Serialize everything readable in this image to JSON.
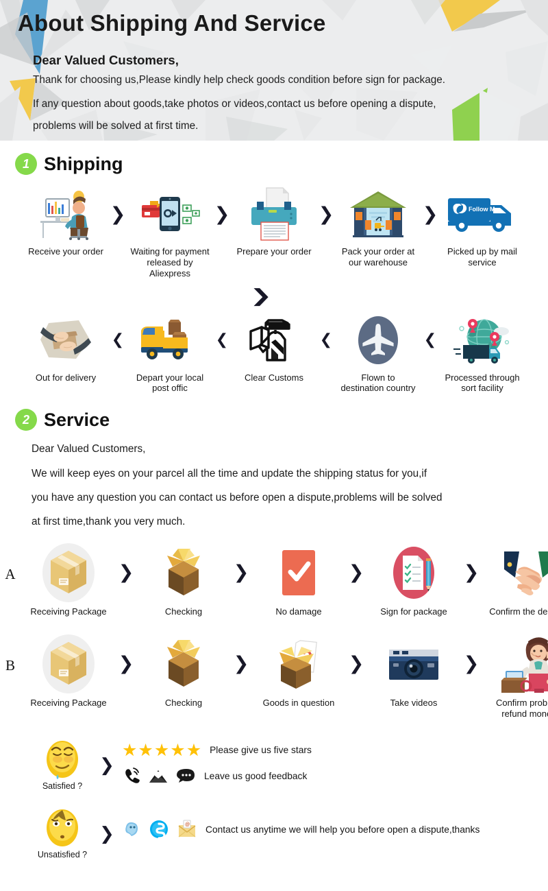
{
  "header": {
    "title": "About Shipping And Service",
    "salutation": "Dear Valued Customers,",
    "line1": "Thank for choosing us,Please kindly help check goods condition before sign for package.",
    "line2": "If any question about goods,take photos or videos,contact us before opening a dispute,",
    "line3": "problems will be solved at first time.",
    "bg_colors": {
      "base": "#ecedee",
      "blue": "#5ba3d0",
      "yellow": "#f2c94c",
      "green": "#8fd14f",
      "grey": "#c9cbcc"
    }
  },
  "sections": [
    {
      "number": "1",
      "title": "Shipping",
      "badge_color": "#85d94a"
    },
    {
      "number": "2",
      "title": "Service",
      "badge_color": "#85d94a"
    }
  ],
  "shipping": {
    "row1": [
      {
        "icon": "person-at-computer-icon",
        "label": "Receive your order"
      },
      {
        "icon": "phone-payment-icon",
        "label": "Waiting for payment\nreleased by Aliexpress"
      },
      {
        "icon": "printer-icon",
        "label": "Prepare your order"
      },
      {
        "icon": "warehouse-icon",
        "label": "Pack your order at\nour warehouse"
      },
      {
        "icon": "delivery-truck-follow-me-icon",
        "label": "Picked up by mail service"
      }
    ],
    "row1_chevron": "❯",
    "row2": [
      {
        "icon": "hands-package-icon",
        "label": "Out for delivery"
      },
      {
        "icon": "yellow-van-icon",
        "label": "Depart your local\npost offic"
      },
      {
        "icon": "customs-officer-icon",
        "label": "Clear Customs"
      },
      {
        "icon": "airplane-icon",
        "label": "Flown to\ndestination country"
      },
      {
        "icon": "globe-sort-facility-icon",
        "label": "Processed through\nsort facility"
      }
    ],
    "row2_chevron": "❮",
    "down_chevron": "⌄",
    "truck_badge_text": "Follow Me"
  },
  "service": {
    "salutation": "Dear Valued Customers,",
    "line1": "We will keep eyes on your parcel all the time and update the shipping status for you,if",
    "line2": "you have any question you can contact us before open a dispute,problems will be solved",
    "line3": "at first time,thank you very much.",
    "rowA": {
      "letter": "A",
      "chevron": "❯",
      "steps": [
        {
          "icon": "package-box-icon",
          "label": "Receiving Package"
        },
        {
          "icon": "open-box-icon",
          "label": "Checking"
        },
        {
          "icon": "checkmark-icon",
          "label": "No damage"
        },
        {
          "icon": "checklist-pencil-icon",
          "label": "Sign for package"
        },
        {
          "icon": "handshake-icon",
          "label": "Confirm the delivery"
        }
      ]
    },
    "rowB": {
      "letter": "B",
      "chevron": "❯",
      "steps": [
        {
          "icon": "package-box-icon",
          "label": "Receiving Package"
        },
        {
          "icon": "open-box-icon",
          "label": "Checking"
        },
        {
          "icon": "question-box-icon",
          "label": "Goods in question"
        },
        {
          "icon": "camera-icon",
          "label": "Take videos"
        },
        {
          "icon": "customer-service-agent-icon",
          "label": "Confirm problem\nrefund money"
        }
      ]
    }
  },
  "feedback": {
    "satisfied": {
      "emoji": "satisfied-face-icon",
      "caption": "Satisfied ?",
      "chevron": "❯",
      "stars": 5,
      "star_glyph": "★",
      "star_color": "#ffc107",
      "stars_label": "Please give us five stars",
      "contact_label": "Leave us good feedback",
      "contact_icons": [
        "phone-ringing-icon",
        "envelope-icon",
        "speech-bubble-icon"
      ]
    },
    "unsatisfied": {
      "emoji": "unsatisfied-face-icon",
      "caption": "Unsatisfied ?",
      "chevron": "❯",
      "contact_icons": [
        "trademanager-icon",
        "skype-icon",
        "email-at-icon"
      ],
      "label": "Contact us anytime we will help you before open a dispute,thanks"
    }
  }
}
